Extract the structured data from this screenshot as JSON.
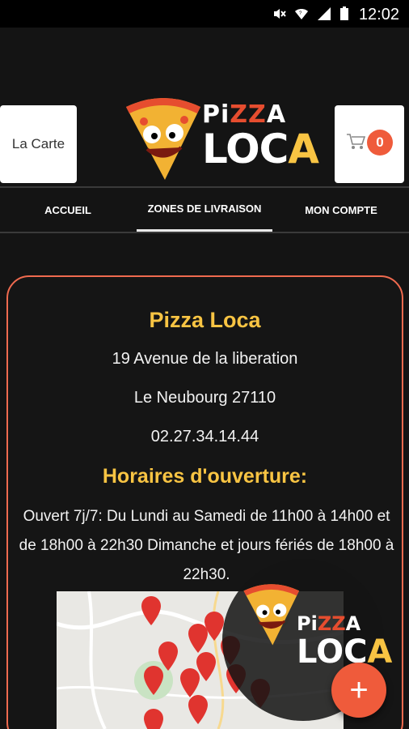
{
  "status_bar": {
    "time": "12:02",
    "icons": [
      "mute-icon",
      "wifi-icon",
      "signal-icon",
      "battery-icon"
    ]
  },
  "header": {
    "menu_button_label": "La Carte",
    "cart_count": "0",
    "logo": {
      "line1": "PiZZA",
      "line2": "LOCA"
    }
  },
  "nav": {
    "tabs": [
      {
        "label": "ACCUEIL",
        "active": false
      },
      {
        "label": "ZONES DE LIVRAISON",
        "active": true
      },
      {
        "label": "MON COMPTE",
        "active": false
      }
    ]
  },
  "restaurant": {
    "name": "Pizza Loca",
    "address": "19 Avenue de la liberation",
    "city": "Le Neubourg 27110",
    "phone": "02.27.34.14.44",
    "hours_title": "Horaires d'ouverture:",
    "hours_text": "Ouvert 7j/7: Du Lundi au Samedi de 11h00 à 14h00 et de 18h00 à 22h30 Dimanche et jours fériés de 18h00 à 22h30."
  },
  "floating": {
    "logo_line1": "PiZZA",
    "logo_line2": "LOCA",
    "fab_label": "+"
  },
  "colors": {
    "background": "#141414",
    "accent": "#ef5b3b",
    "title_yellow": "#f8c443",
    "card_border": "#ef6a4f"
  }
}
